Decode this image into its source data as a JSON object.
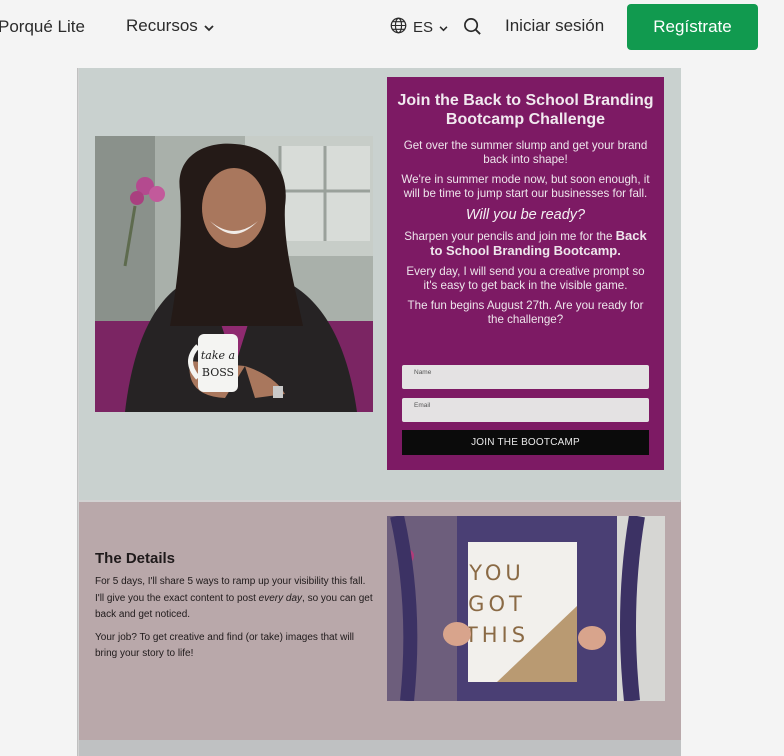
{
  "nav": {
    "porque": "Porqué Lite",
    "recursos": "Recursos",
    "lang": "ES",
    "login": "Iniciar sesión",
    "signup": "Regístrate"
  },
  "hero": {
    "photo_alt": "take a BOSS",
    "card": {
      "title": "Join the Back to School Branding Bootcamp Challenge",
      "p1": "Get over the summer slump and get your brand back into shape!",
      "p2": "We're in summer mode now, but soon enough, it will be time to jump start our businesses for fall.",
      "ready": "Will you be ready?",
      "p3_pre": "Sharpen your pencils and join me for the ",
      "p3_bold": "Back to School Branding Bootcamp.",
      "p4": "Every day, I will send you a creative prompt so it's easy to get back in the visible game.",
      "p5": "The fun begins August 27th. Are you ready for the challenge?",
      "name_placeholder": "Name",
      "email_placeholder": "Email",
      "button": "JOIN THE BOOTCAMP"
    }
  },
  "details": {
    "title": "The Details",
    "p1_pre": "For 5 days, I'll share 5 ways to ramp up your visibility this fall. I'll give you the exact content to post ",
    "p1_em": "every day",
    "p1_post": ", so you can get back and get noticed.",
    "p2": "Your job?  To get creative and find (or take) images that will bring your story to life!",
    "sign_lines": [
      "YOU",
      "GOT",
      "THIS"
    ]
  },
  "colors": {
    "signup_green": "#119a4f",
    "card_purple": "#7d1a64",
    "section1_bg": "#c9d1cf",
    "section2_bg": "#b9a8aa"
  }
}
